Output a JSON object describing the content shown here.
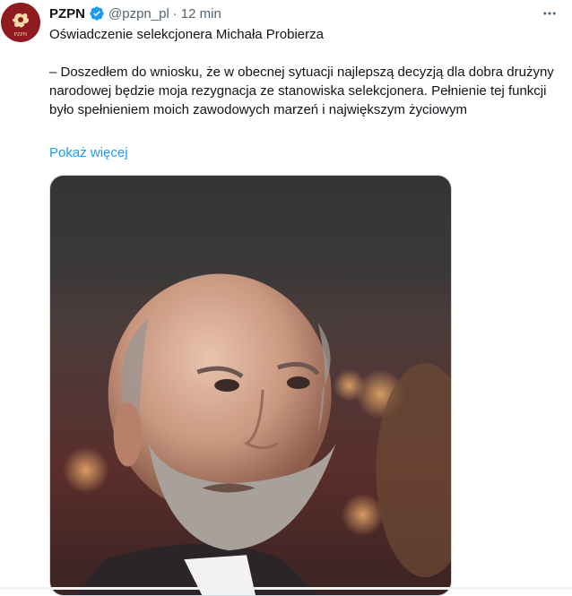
{
  "tweet": {
    "author_name": "PZPN",
    "handle": "@pzpn_pl",
    "separator": "·",
    "time": "12 min",
    "avatar_text": "PZPN",
    "text_title": "Oświadczenie selekcjonera Michała Probierza",
    "text_body": "– Doszedłem do wniosku, że w obecnej sytuacji najlepszą decyzją dla dobra drużyny narodowej będzie moja rezygnacja ze stanowiska selekcjonera. Pełnienie tej funkcji było spełnieniem moich zawodowych marzeń i największym życiowym",
    "show_more": "Pokaż więcej",
    "more_icon": "more-horizontal-icon",
    "verified_icon": "verified-badge-icon"
  },
  "colors": {
    "link": "#1d9bf0",
    "verified": "#1d9bf0",
    "secondary_text": "#536471",
    "avatar_bg": "#8f1a1f"
  }
}
